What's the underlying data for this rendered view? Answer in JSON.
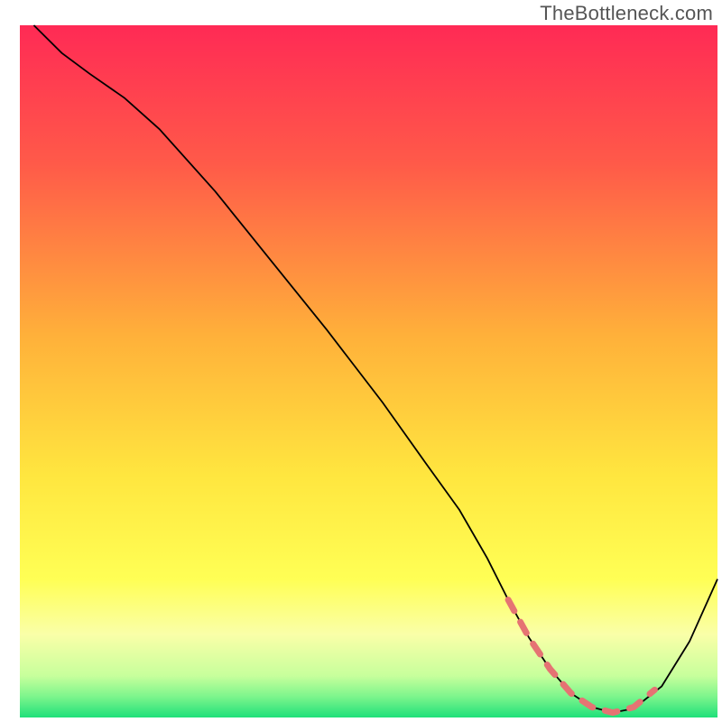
{
  "watermark": "TheBottleneck.com",
  "chart_data": {
    "type": "line",
    "title": "",
    "xlabel": "",
    "ylabel": "",
    "xlim": [
      0,
      100
    ],
    "ylim": [
      0,
      100
    ],
    "background": {
      "type": "vertical-gradient",
      "stops": [
        {
          "offset": 0.0,
          "color": "#ff2a55"
        },
        {
          "offset": 0.2,
          "color": "#ff5a49"
        },
        {
          "offset": 0.45,
          "color": "#ffb13a"
        },
        {
          "offset": 0.65,
          "color": "#ffe63f"
        },
        {
          "offset": 0.8,
          "color": "#ffff55"
        },
        {
          "offset": 0.88,
          "color": "#faffa8"
        },
        {
          "offset": 0.94,
          "color": "#c7ff9c"
        },
        {
          "offset": 0.97,
          "color": "#7cf58c"
        },
        {
          "offset": 1.0,
          "color": "#1fe07a"
        }
      ]
    },
    "series": [
      {
        "name": "curve",
        "color": "#000000",
        "stroke_width": 1.8,
        "x": [
          2,
          6,
          10,
          15,
          20,
          28,
          36,
          44,
          52,
          58,
          63,
          67,
          70,
          73,
          76,
          79,
          82,
          85,
          88,
          92,
          96,
          100
        ],
        "y": [
          100,
          96,
          93,
          89.5,
          85,
          76,
          66,
          56,
          45.5,
          37,
          30,
          23,
          17,
          11.5,
          7,
          3.5,
          1.5,
          0.7,
          1.3,
          4.5,
          11,
          20
        ]
      },
      {
        "name": "highlight",
        "color": "#e57373",
        "stroke_width": 7,
        "dash": [
          14,
          14
        ],
        "linecap": "round",
        "x": [
          70,
          73,
          76,
          79,
          82,
          85,
          88,
          91
        ],
        "y": [
          17,
          11.5,
          7,
          3.5,
          1.5,
          0.7,
          1.5,
          4
        ]
      }
    ]
  }
}
